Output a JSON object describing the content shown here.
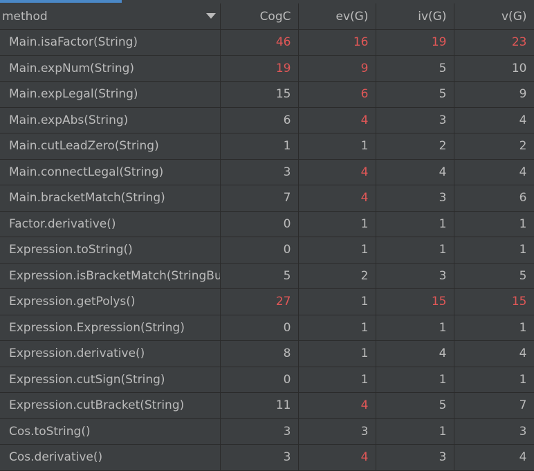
{
  "columns": [
    {
      "label": "method",
      "name": "column-header-method"
    },
    {
      "label": "CogC",
      "name": "column-header-cogc"
    },
    {
      "label": "ev(G)",
      "name": "column-header-evg"
    },
    {
      "label": "iv(G)",
      "name": "column-header-ivg"
    },
    {
      "label": "v(G)",
      "name": "column-header-vg"
    }
  ],
  "colors": {
    "warning": "#e05757",
    "normal": "#bbbbbb",
    "background": "#3c3f41",
    "grid": "#2b2b2b",
    "scroll_indicator": "#4a88c7"
  },
  "rows": [
    {
      "method": "Main.isaFactor(String)",
      "values": [
        {
          "v": "46",
          "warn": true
        },
        {
          "v": "16",
          "warn": true
        },
        {
          "v": "19",
          "warn": true
        },
        {
          "v": "23",
          "warn": true
        }
      ]
    },
    {
      "method": "Main.expNum(String)",
      "values": [
        {
          "v": "19",
          "warn": true
        },
        {
          "v": "9",
          "warn": true
        },
        {
          "v": "5",
          "warn": false
        },
        {
          "v": "10",
          "warn": false
        }
      ]
    },
    {
      "method": "Main.expLegal(String)",
      "values": [
        {
          "v": "15",
          "warn": false
        },
        {
          "v": "6",
          "warn": true
        },
        {
          "v": "5",
          "warn": false
        },
        {
          "v": "9",
          "warn": false
        }
      ]
    },
    {
      "method": "Main.expAbs(String)",
      "values": [
        {
          "v": "6",
          "warn": false
        },
        {
          "v": "4",
          "warn": true
        },
        {
          "v": "3",
          "warn": false
        },
        {
          "v": "4",
          "warn": false
        }
      ]
    },
    {
      "method": "Main.cutLeadZero(String)",
      "values": [
        {
          "v": "1",
          "warn": false
        },
        {
          "v": "1",
          "warn": false
        },
        {
          "v": "2",
          "warn": false
        },
        {
          "v": "2",
          "warn": false
        }
      ]
    },
    {
      "method": "Main.connectLegal(String)",
      "values": [
        {
          "v": "3",
          "warn": false
        },
        {
          "v": "4",
          "warn": true
        },
        {
          "v": "4",
          "warn": false
        },
        {
          "v": "4",
          "warn": false
        }
      ]
    },
    {
      "method": "Main.bracketMatch(String)",
      "values": [
        {
          "v": "7",
          "warn": false
        },
        {
          "v": "4",
          "warn": true
        },
        {
          "v": "3",
          "warn": false
        },
        {
          "v": "6",
          "warn": false
        }
      ]
    },
    {
      "method": "Factor.derivative()",
      "values": [
        {
          "v": "0",
          "warn": false
        },
        {
          "v": "1",
          "warn": false
        },
        {
          "v": "1",
          "warn": false
        },
        {
          "v": "1",
          "warn": false
        }
      ]
    },
    {
      "method": "Expression.toString()",
      "values": [
        {
          "v": "0",
          "warn": false
        },
        {
          "v": "1",
          "warn": false
        },
        {
          "v": "1",
          "warn": false
        },
        {
          "v": "1",
          "warn": false
        }
      ]
    },
    {
      "method": "Expression.isBracketMatch(StringBu",
      "values": [
        {
          "v": "5",
          "warn": false
        },
        {
          "v": "2",
          "warn": false
        },
        {
          "v": "3",
          "warn": false
        },
        {
          "v": "5",
          "warn": false
        }
      ]
    },
    {
      "method": "Expression.getPolys()",
      "values": [
        {
          "v": "27",
          "warn": true
        },
        {
          "v": "1",
          "warn": false
        },
        {
          "v": "15",
          "warn": true
        },
        {
          "v": "15",
          "warn": true
        }
      ]
    },
    {
      "method": "Expression.Expression(String)",
      "values": [
        {
          "v": "0",
          "warn": false
        },
        {
          "v": "1",
          "warn": false
        },
        {
          "v": "1",
          "warn": false
        },
        {
          "v": "1",
          "warn": false
        }
      ]
    },
    {
      "method": "Expression.derivative()",
      "values": [
        {
          "v": "8",
          "warn": false
        },
        {
          "v": "1",
          "warn": false
        },
        {
          "v": "4",
          "warn": false
        },
        {
          "v": "4",
          "warn": false
        }
      ]
    },
    {
      "method": "Expression.cutSign(String)",
      "values": [
        {
          "v": "0",
          "warn": false
        },
        {
          "v": "1",
          "warn": false
        },
        {
          "v": "1",
          "warn": false
        },
        {
          "v": "1",
          "warn": false
        }
      ]
    },
    {
      "method": "Expression.cutBracket(String)",
      "values": [
        {
          "v": "11",
          "warn": false
        },
        {
          "v": "4",
          "warn": true
        },
        {
          "v": "5",
          "warn": false
        },
        {
          "v": "7",
          "warn": false
        }
      ]
    },
    {
      "method": "Cos.toString()",
      "values": [
        {
          "v": "3",
          "warn": false
        },
        {
          "v": "3",
          "warn": false
        },
        {
          "v": "1",
          "warn": false
        },
        {
          "v": "3",
          "warn": false
        }
      ]
    },
    {
      "method": "Cos.derivative()",
      "values": [
        {
          "v": "3",
          "warn": false
        },
        {
          "v": "4",
          "warn": true
        },
        {
          "v": "3",
          "warn": false
        },
        {
          "v": "4",
          "warn": false
        }
      ]
    }
  ]
}
